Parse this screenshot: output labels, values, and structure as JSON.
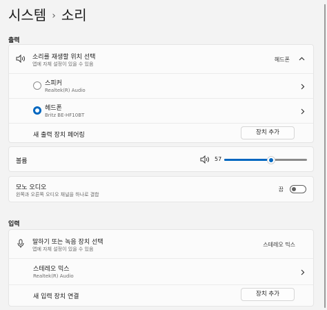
{
  "breadcrumb": {
    "parent": "시스템",
    "separator": "›",
    "current": "소리"
  },
  "output": {
    "heading": "출력",
    "select": {
      "title": "소리를 재생할 위치 선택",
      "subtitle": "앱에 자체 설정이 있을 수 있음",
      "value": "헤드폰"
    },
    "devices": [
      {
        "name": "스피커",
        "detail": "Realtek(R) Audio",
        "selected": false
      },
      {
        "name": "헤드폰",
        "detail": "Britz BE-HF10BT",
        "selected": true
      }
    ],
    "pair": {
      "label": "새 출력 장치 페어링",
      "button": "장치 추가"
    }
  },
  "volume": {
    "label": "볼륨",
    "value": "57",
    "level": 57
  },
  "mono": {
    "title": "모노 오디오",
    "subtitle": "왼쪽과 오른쪽 오디오 채널을 하나로 결합",
    "state": "끔"
  },
  "input": {
    "heading": "입력",
    "select": {
      "title": "말하기 또는 녹음 장치 선택",
      "subtitle": "앱에 자체 설정이 있을 수 있음",
      "value": "스테레오 믹스"
    },
    "devices": [
      {
        "name": "스테레오 믹스",
        "detail": "Realtek(R) Audio"
      }
    ],
    "connect": {
      "label": "새 입력 장치 연결",
      "button": "장치 추가"
    }
  },
  "colors": {
    "accent": "#0067c0",
    "background": "#f3f3f3",
    "card": "#fbfbfb"
  },
  "icons": [
    "speaker-icon",
    "chevron-up-icon",
    "chevron-right-icon",
    "microphone-icon"
  ]
}
